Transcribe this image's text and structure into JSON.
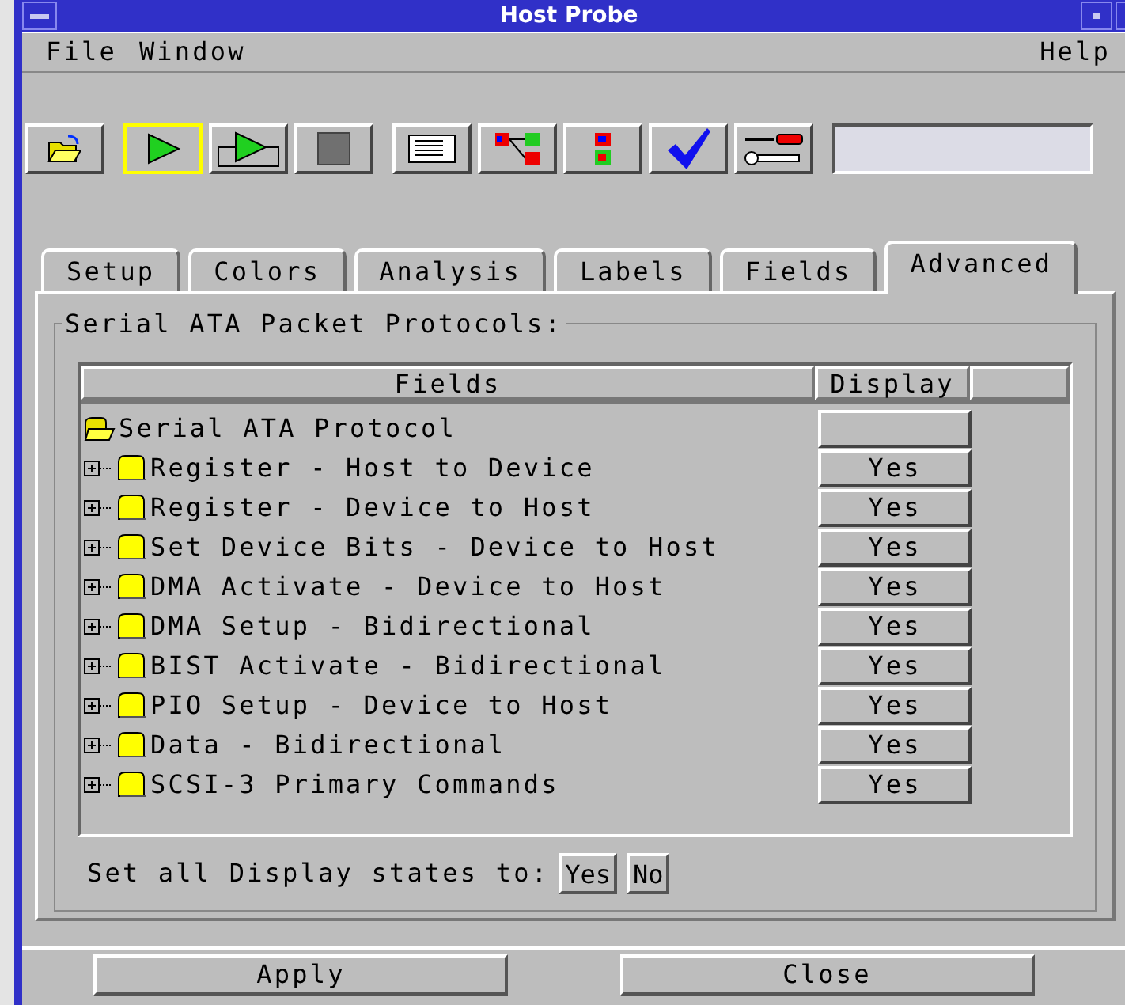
{
  "window": {
    "title": "Host Probe"
  },
  "menu": {
    "left": [
      "File",
      "Window"
    ],
    "right": [
      "Help"
    ]
  },
  "toolbar": [
    {
      "kind": "open",
      "selected": false
    },
    {
      "kind": "run",
      "selected": true
    },
    {
      "kind": "run-repetitive",
      "selected": false
    },
    {
      "kind": "stop",
      "selected": false
    },
    {
      "kind": "list",
      "selected": false
    },
    {
      "kind": "tree",
      "selected": false
    },
    {
      "kind": "chip",
      "selected": false
    },
    {
      "kind": "check",
      "selected": false
    },
    {
      "kind": "tools",
      "selected": false
    }
  ],
  "tabs": [
    {
      "label": "Setup",
      "selected": false
    },
    {
      "label": "Colors",
      "selected": false
    },
    {
      "label": "Analysis",
      "selected": false
    },
    {
      "label": "Labels",
      "selected": false
    },
    {
      "label": "Fields",
      "selected": false
    },
    {
      "label": "Advanced",
      "selected": true
    }
  ],
  "group": {
    "title": "Serial ATA Packet Protocols:"
  },
  "table": {
    "columns": [
      "Fields",
      "Display"
    ],
    "tree": [
      {
        "label": "Serial ATA Protocol",
        "expanded": true,
        "children": [
          {
            "label": "Register - Host to Device",
            "expanded": false,
            "display": "Yes"
          },
          {
            "label": "Register - Device to Host",
            "expanded": false,
            "display": "Yes"
          },
          {
            "label": "Set Device Bits - Device to Host",
            "expanded": false,
            "display": "Yes"
          },
          {
            "label": "DMA Activate - Device to Host",
            "expanded": false,
            "display": "Yes"
          },
          {
            "label": "DMA Setup - Bidirectional",
            "expanded": false,
            "display": "Yes"
          },
          {
            "label": "BIST Activate - Bidirectional",
            "expanded": false,
            "display": "Yes"
          },
          {
            "label": "PIO Setup - Device to Host",
            "expanded": false,
            "display": "Yes"
          },
          {
            "label": "Data - Bidirectional",
            "expanded": false,
            "display": "Yes"
          },
          {
            "label": "SCSI-3 Primary Commands",
            "expanded": false,
            "display": "Yes"
          }
        ]
      }
    ]
  },
  "set_all": {
    "label": "Set all Display states to:",
    "buttons": [
      "Yes",
      "No"
    ]
  },
  "buttons": [
    "Apply",
    "Close"
  ]
}
